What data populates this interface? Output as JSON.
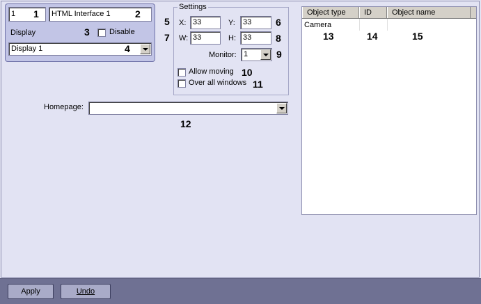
{
  "identity": {
    "id_value": "1",
    "name_value": "HTML Interface 1",
    "display_label": "Display",
    "disable_label": "Disable",
    "display_select": "Display 1"
  },
  "settings": {
    "group_title": "Settings",
    "x_label": "X:",
    "x_value": "33",
    "y_label": "Y:",
    "y_value": "33",
    "w_label": "W:",
    "w_value": "33",
    "h_label": "H:",
    "h_value": "33",
    "monitor_label": "Monitor:",
    "monitor_value": "1",
    "allow_moving_label": "Allow moving",
    "over_all_windows_label": "Over all windows"
  },
  "homepage": {
    "label": "Homepage:",
    "value": ""
  },
  "objects_table": {
    "columns": [
      "Object type",
      "ID",
      "Object name"
    ],
    "rows": [
      {
        "type": "Camera",
        "id": "",
        "name": ""
      }
    ]
  },
  "callouts": [
    "1",
    "2",
    "3",
    "4",
    "5",
    "6",
    "7",
    "8",
    "9",
    "10",
    "11",
    "12",
    "13",
    "14",
    "15"
  ],
  "buttons": {
    "apply": "Apply",
    "undo": "Undo"
  },
  "colors": {
    "background": "#e2e3f3",
    "panel": "#c2c5e6",
    "bottom_bar": "#6f7193",
    "button": "#a9abc8"
  }
}
